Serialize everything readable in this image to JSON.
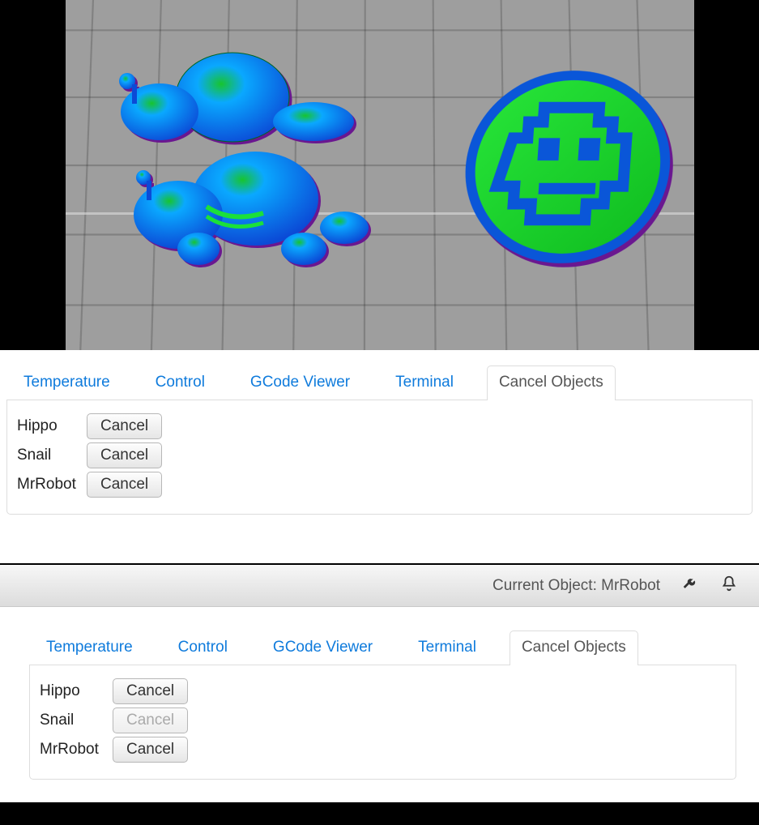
{
  "tabs": {
    "temperature": "Temperature",
    "control": "Control",
    "gcode": "GCode Viewer",
    "terminal": "Terminal",
    "cancel": "Cancel Objects"
  },
  "panel1": {
    "objects": [
      {
        "name": "Hippo",
        "button": "Cancel",
        "disabled": false
      },
      {
        "name": "Snail",
        "button": "Cancel",
        "disabled": false
      },
      {
        "name": "MrRobot",
        "button": "Cancel",
        "disabled": false
      }
    ]
  },
  "toolbar": {
    "current_label": "Current Object:",
    "current_value": "MrRobot"
  },
  "panel2": {
    "objects": [
      {
        "name": "Hippo",
        "button": "Cancel",
        "disabled": false
      },
      {
        "name": "Snail",
        "button": "Cancel",
        "disabled": true
      },
      {
        "name": "MrRobot",
        "button": "Cancel",
        "disabled": false
      }
    ]
  }
}
